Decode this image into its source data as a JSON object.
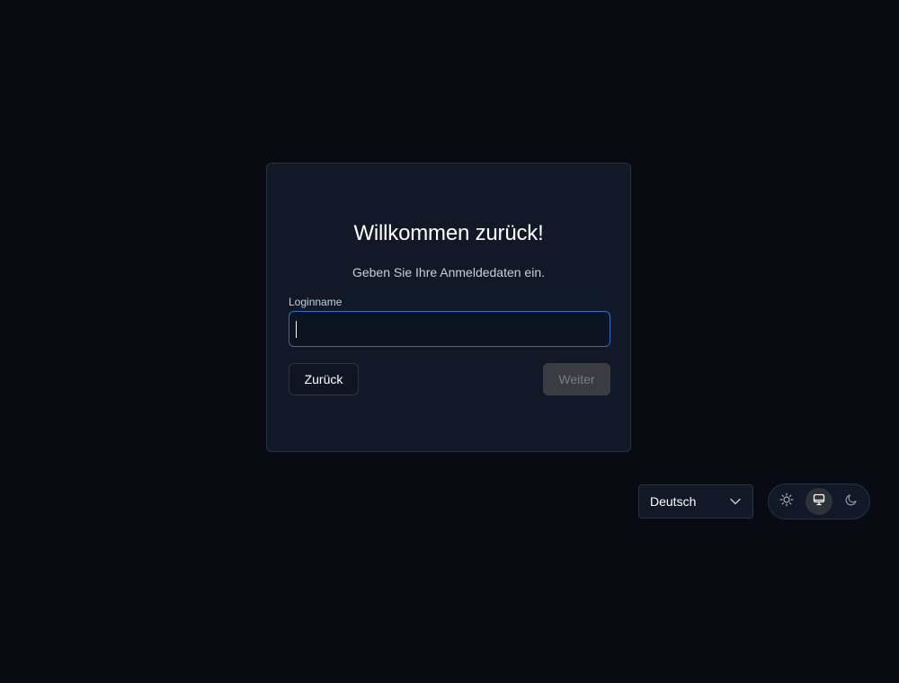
{
  "login": {
    "title": "Willkommen zurück!",
    "subtitle": "Geben Sie Ihre Anmeldedaten ein.",
    "login_label": "Loginname",
    "login_value": "",
    "back_label": "Zurück",
    "next_label": "Weiter"
  },
  "footer": {
    "language": {
      "selected": "Deutsch"
    },
    "theme": {
      "options": [
        {
          "name": "light",
          "icon": "sun-icon"
        },
        {
          "name": "system",
          "icon": "monitor-icon",
          "selected": true
        },
        {
          "name": "dark",
          "icon": "moon-icon"
        }
      ]
    }
  },
  "colors": {
    "background": "#090b12",
    "card": "#111827",
    "focus_border": "#2f6fc9",
    "disabled_button": "#3a3c41"
  }
}
